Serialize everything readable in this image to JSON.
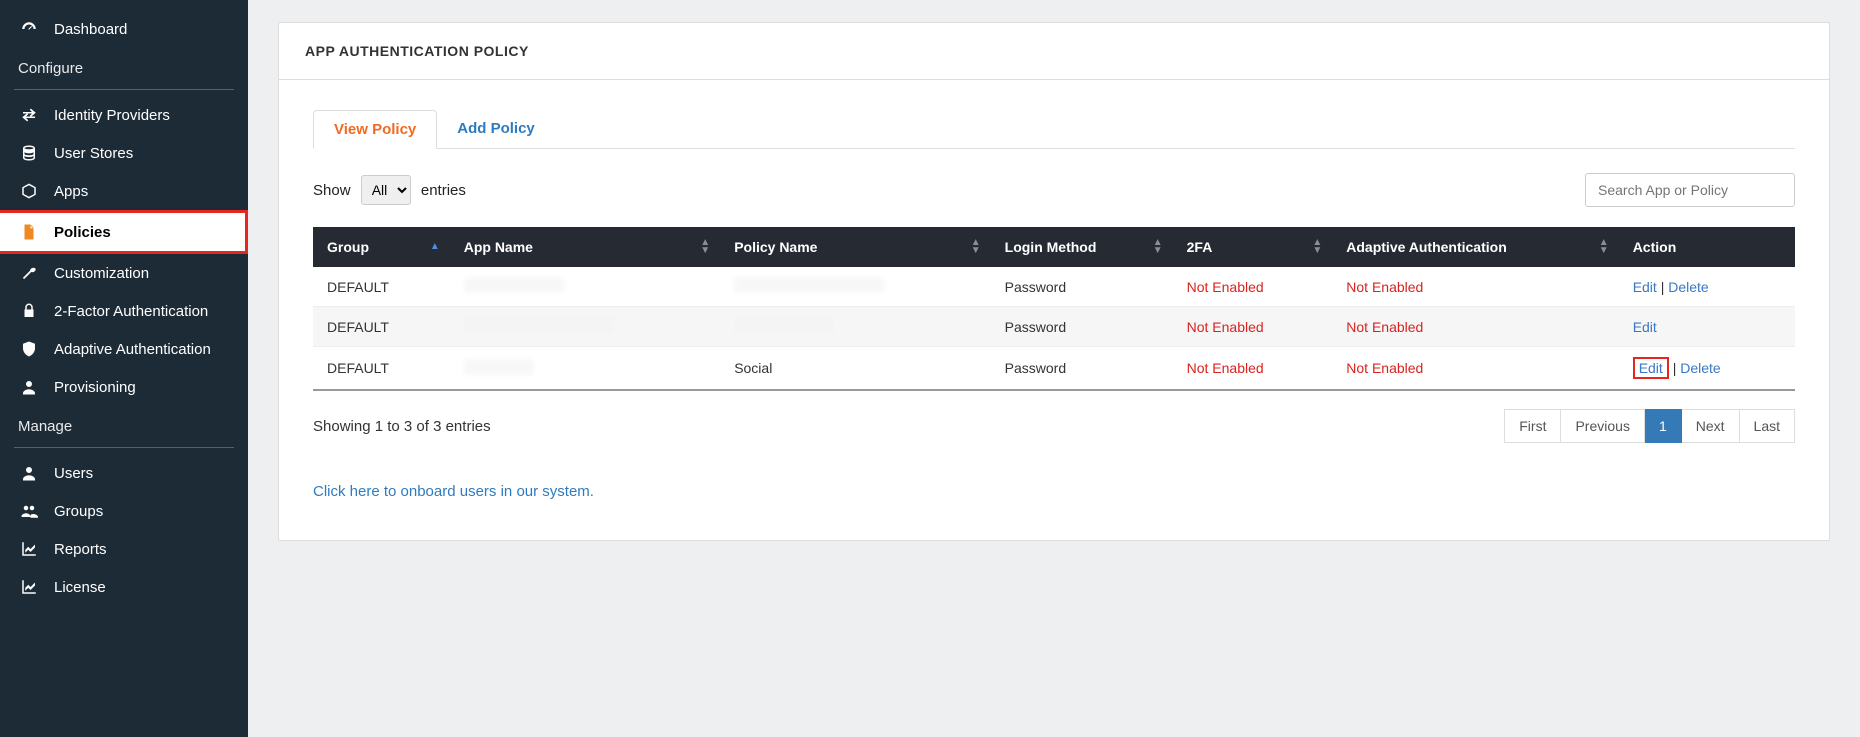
{
  "sidebar": {
    "items": [
      {
        "label": "Dashboard"
      },
      {
        "section": "Configure"
      },
      {
        "label": "Identity Providers"
      },
      {
        "label": "User Stores"
      },
      {
        "label": "Apps"
      },
      {
        "label": "Policies"
      },
      {
        "label": "Customization"
      },
      {
        "label": "2-Factor Authentication"
      },
      {
        "label": "Adaptive Authentication"
      },
      {
        "label": "Provisioning"
      },
      {
        "section": "Manage"
      },
      {
        "label": "Users"
      },
      {
        "label": "Groups"
      },
      {
        "label": "Reports"
      },
      {
        "label": "License"
      }
    ]
  },
  "header": {
    "title": "APP AUTHENTICATION POLICY"
  },
  "tabs": {
    "view": "View Policy",
    "add": "Add Policy"
  },
  "entries": {
    "show": "Show",
    "option": "All",
    "suffix": "entries"
  },
  "search": {
    "placeholder": "Search App or Policy"
  },
  "columns": {
    "group": "Group",
    "app": "App Name",
    "policy": "Policy Name",
    "login": "Login Method",
    "twofa": "2FA",
    "adaptive": "Adaptive Authentication",
    "action": "Action"
  },
  "rows": [
    {
      "group": "DEFAULT",
      "login": "Password",
      "twofa": "Not Enabled",
      "adaptive": "Not Enabled",
      "edit": "Edit",
      "sep": " | ",
      "delete": "Delete"
    },
    {
      "group": "DEFAULT",
      "login": "Password",
      "twofa": "Not Enabled",
      "adaptive": "Not Enabled",
      "edit": "Edit"
    },
    {
      "group": "DEFAULT",
      "policy": "Social",
      "login": "Password",
      "twofa": "Not Enabled",
      "adaptive": "Not Enabled",
      "edit": "Edit",
      "sep": " | ",
      "delete": "Delete"
    }
  ],
  "footer": {
    "info": "Showing 1 to 3 of 3 entries"
  },
  "pager": {
    "first": "First",
    "prev": "Previous",
    "p1": "1",
    "next": "Next",
    "last": "Last"
  },
  "onboard": {
    "text": "Click here to onboard users in our system."
  }
}
